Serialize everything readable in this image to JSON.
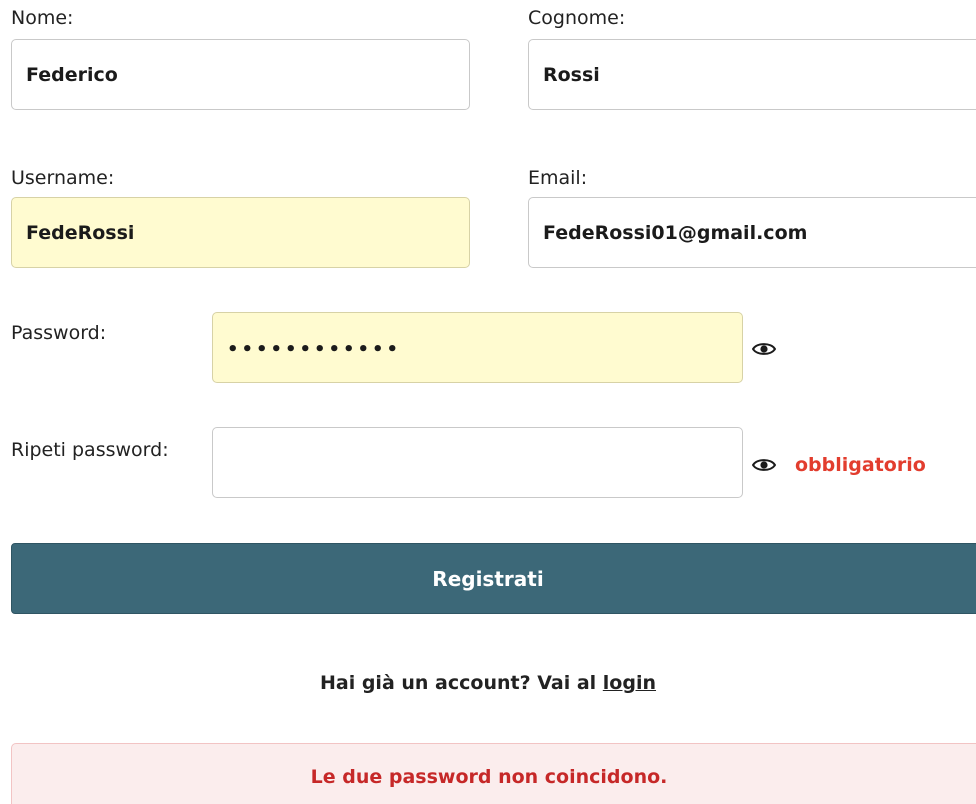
{
  "form": {
    "nome": {
      "label": "Nome:",
      "value": "Federico"
    },
    "cognome": {
      "label": "Cognome:",
      "value": "Rossi"
    },
    "username": {
      "label": "Username:",
      "value": "FedeRossi"
    },
    "email": {
      "label": "Email:",
      "value": "FedeRossi01@gmail.com"
    },
    "password": {
      "label": "Password:",
      "value": "••••••••••••",
      "toggle_icon": "eye-icon"
    },
    "repeat_password": {
      "label": "Ripeti password:",
      "value": "",
      "toggle_icon": "eye-icon",
      "required_text": "obbligatorio"
    }
  },
  "submit_label": "Registrati",
  "login_prompt": {
    "text": "Hai già un account? Vai al ",
    "link_text": "login"
  },
  "error_message": "Le due password non coincidono.",
  "colors": {
    "button": "#3c6878",
    "autofill": "#fffbd0",
    "required": "#e23d2e",
    "error_text": "#c62828",
    "error_bg": "#fbeded"
  }
}
